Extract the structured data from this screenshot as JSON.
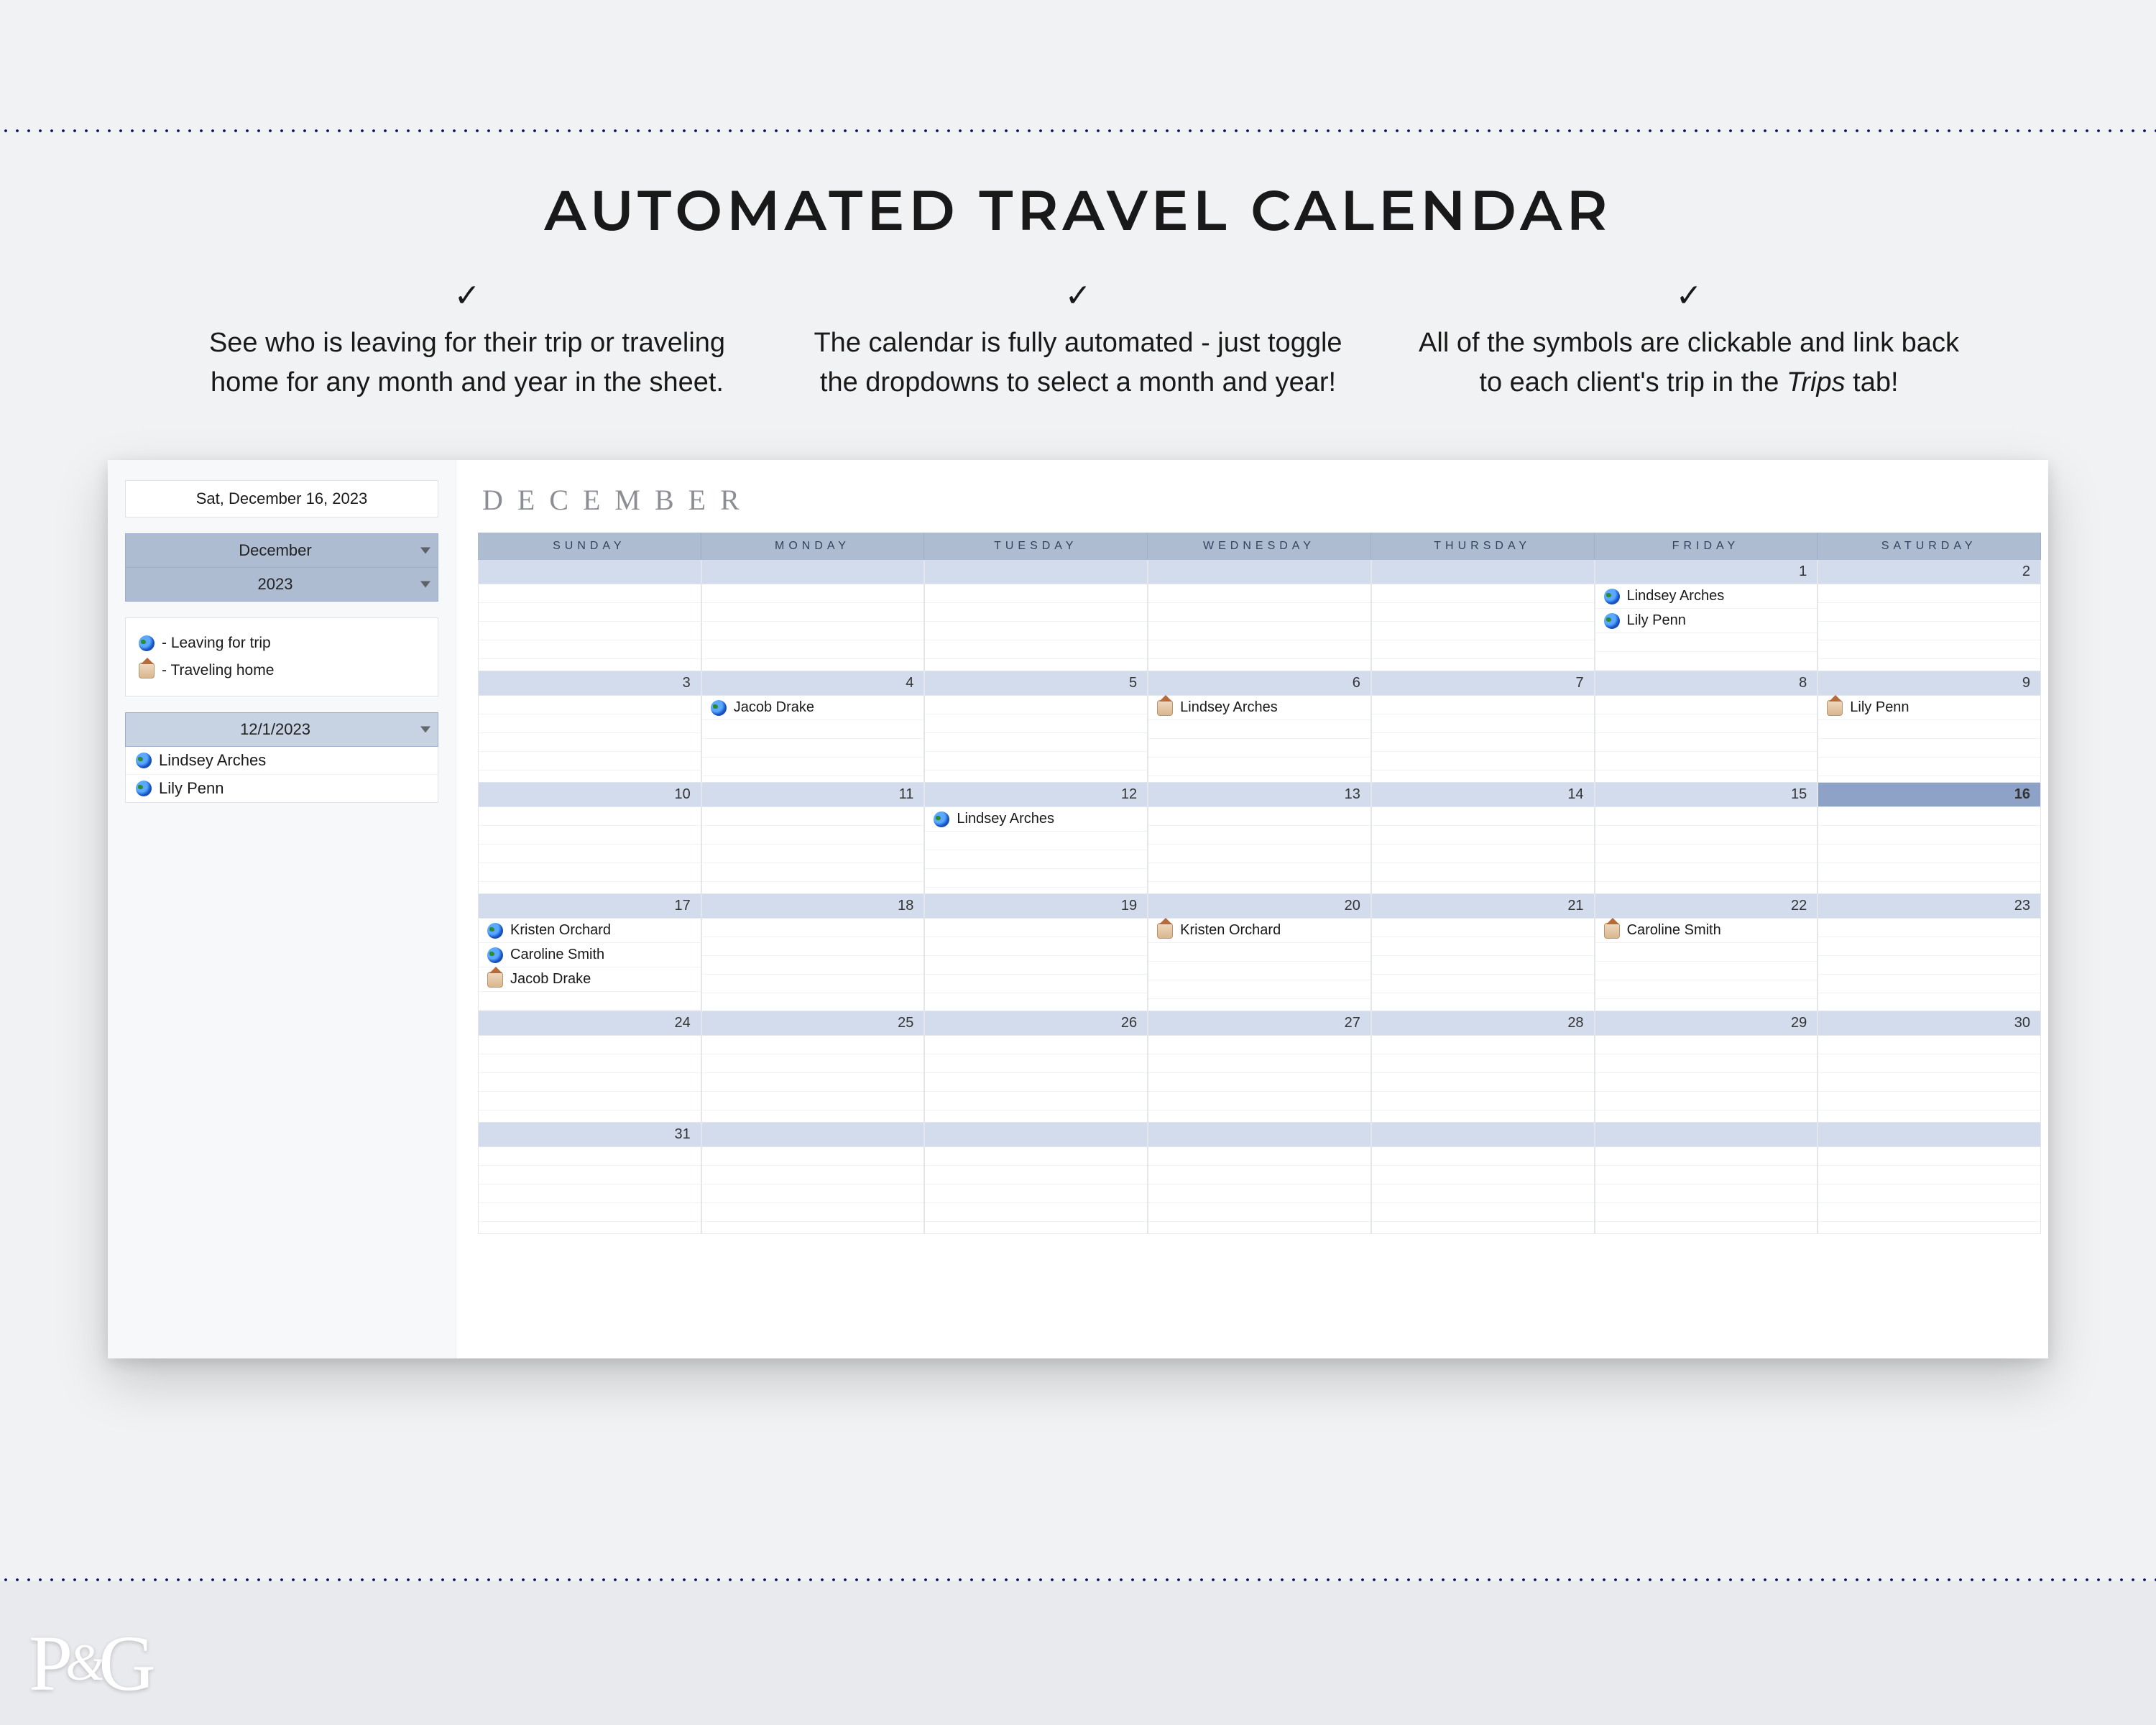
{
  "header": {
    "title": "AUTOMATED TRAVEL CALENDAR",
    "features": [
      "See who is leaving for their trip or traveling home for any month and year in the sheet.",
      "The calendar is fully automated - just toggle the dropdowns to select a month and year!",
      "All of the symbols are clickable and link back to each client's trip in the Trips tab!"
    ]
  },
  "sidebar": {
    "today_label": "Sat, December 16, 2023",
    "month_dd": "December",
    "year_dd": "2023",
    "legend": {
      "leaving": "- Leaving for trip",
      "home": "- Traveling home"
    },
    "selected_date_dd": "12/1/2023",
    "selected_list": [
      {
        "icon": "globe",
        "name": "Lindsey Arches"
      },
      {
        "icon": "globe",
        "name": "Lily Penn"
      }
    ]
  },
  "calendar": {
    "month_title": "DECEMBER",
    "dow": [
      "SUNDAY",
      "MONDAY",
      "TUESDAY",
      "WEDNESDAY",
      "THURSDAY",
      "FRIDAY",
      "SATURDAY"
    ],
    "today": 16,
    "first_dow": 5,
    "days_in_month": 31,
    "events": {
      "1": [
        {
          "icon": "globe",
          "name": "Lindsey Arches"
        },
        {
          "icon": "globe",
          "name": "Lily Penn"
        }
      ],
      "4": [
        {
          "icon": "globe",
          "name": "Jacob Drake"
        }
      ],
      "6": [
        {
          "icon": "home",
          "name": "Lindsey Arches"
        }
      ],
      "9": [
        {
          "icon": "home",
          "name": "Lily Penn"
        }
      ],
      "12": [
        {
          "icon": "globe",
          "name": "Lindsey Arches"
        }
      ],
      "17": [
        {
          "icon": "globe",
          "name": "Kristen Orchard"
        },
        {
          "icon": "globe",
          "name": "Caroline Smith"
        },
        {
          "icon": "home",
          "name": "Jacob Drake"
        }
      ],
      "20": [
        {
          "icon": "home",
          "name": "Kristen Orchard"
        }
      ],
      "22": [
        {
          "icon": "home",
          "name": "Caroline Smith"
        }
      ]
    }
  },
  "logo": {
    "p": "P",
    "amp": "&",
    "g": "G"
  }
}
